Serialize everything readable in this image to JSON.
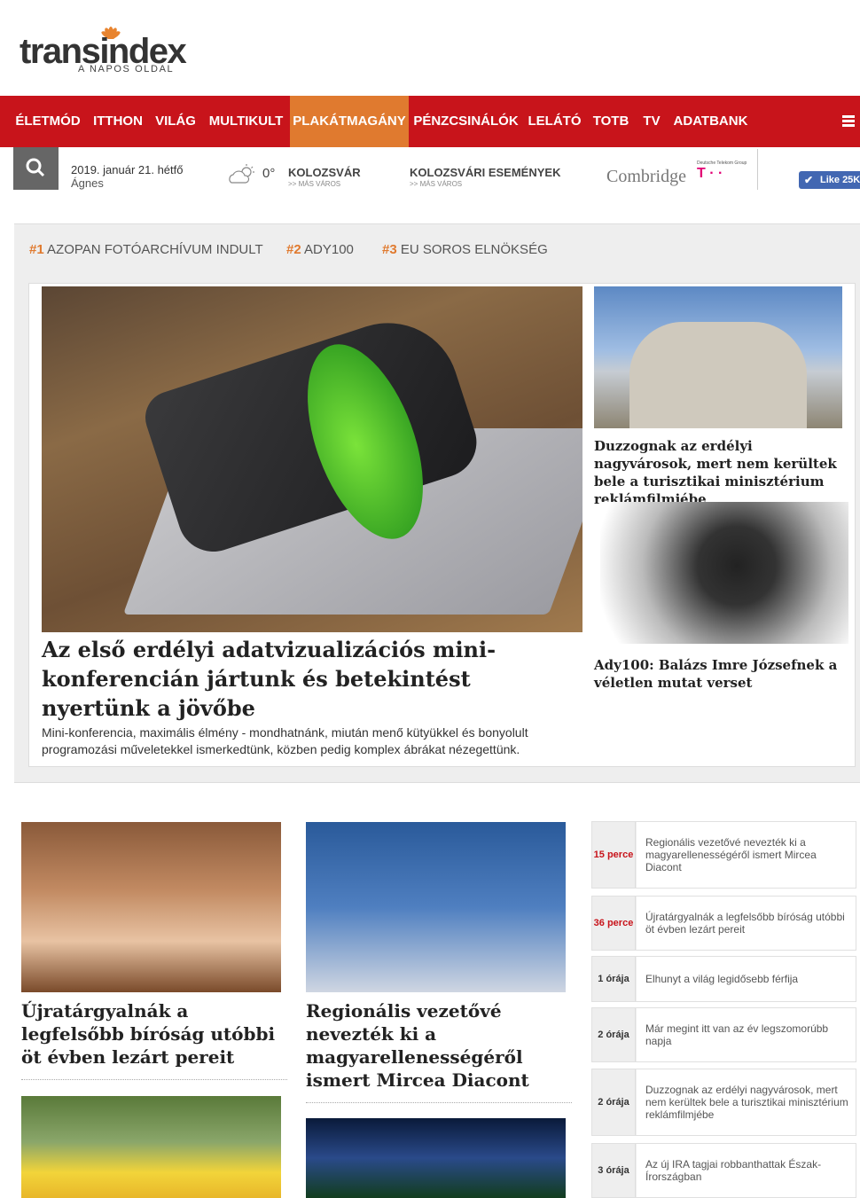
{
  "header": {
    "logo_text": "transindex",
    "logo_sub": "A NAPOS OLDAL"
  },
  "nav": {
    "items": [
      "ÉLETMÓD",
      "ITTHON",
      "VILÁG",
      "MULTIKULT",
      "PLAKÁTMAGÁNY",
      "PÉNZCSINÁLÓK",
      "LELÁTÓ",
      "TOTB",
      "TV",
      "ADATBANK"
    ],
    "active": "PLAKÁTMAGÁNY"
  },
  "subbar": {
    "date": "2019. január 21. hétfő",
    "nameday": "Ágnes",
    "temperature": "0°",
    "city": "KOLOZSVÁR",
    "city_sub": ">> MÁS VÁROS",
    "events": "KOLOZSVÁRI ESEMÉNYEK",
    "events_sub": ">> MÁS VÁROS",
    "sponsor": "Combridge",
    "sponsor_group": "Deutsche Telekom Group",
    "sponsor_t": "T · ·",
    "like": "Like 25K"
  },
  "trending": [
    {
      "num": "#1",
      "label": "AZOPAN FOTÓARCHÍVUM INDULT"
    },
    {
      "num": "#2",
      "label": "ADY100"
    },
    {
      "num": "#3",
      "label": "EU SOROS ELNÖKSÉG"
    }
  ],
  "featured": {
    "main_title": "Az első erdélyi adatvizualizációs mini-konferencián jártunk és betekintést nyertünk a jövőbe",
    "main_lead": "Mini-konferencia, maximális élmény - mondhatnánk, miután menő kütyükkel és bonyolult programozási műveletekkel ismerkedtünk, közben pedig komplex ábrákat nézegettünk.",
    "side1_title": "Duzzognak az erdélyi nagyvárosok, mert nem kerültek bele a turisztikai minisztérium reklámfilmjébe",
    "side2_title": "Ady100: Balázs Imre Józsefnek a véletlen mutat verset"
  },
  "cards": [
    {
      "title": "Újratárgyalnák a legfelsőbb bíróság utóbbi öt évben lezárt pereit"
    },
    {
      "title": "Regionális vezetővé nevezték ki a magyarellenességéről ismert Mircea Diacont"
    }
  ],
  "news": [
    {
      "time": "15 perce",
      "text": "Regionális vezetővé nevezték ki a magyarellenességéről ismert Mircea Diacont"
    },
    {
      "time": "36 perce",
      "text": "Újratárgyalnák a legfelsőbb bíróság utóbbi öt évben lezárt pereit"
    },
    {
      "time": "1 órája",
      "text": "Elhunyt a világ legidősebb férfija"
    },
    {
      "time": "2 órája",
      "text": "Már megint itt van az év legszomorúbb napja"
    },
    {
      "time": "2 órája",
      "text": "Duzzognak az erdélyi nagyvárosok, mert nem kerültek bele a turisztikai minisztérium reklámfilmjébe"
    },
    {
      "time": "3 órája",
      "text": "Az új IRA tagjai robbanthattak Észak-Írországban"
    }
  ],
  "colors": {
    "brand_red": "#c8141b",
    "accent_orange": "#e07a2f"
  }
}
